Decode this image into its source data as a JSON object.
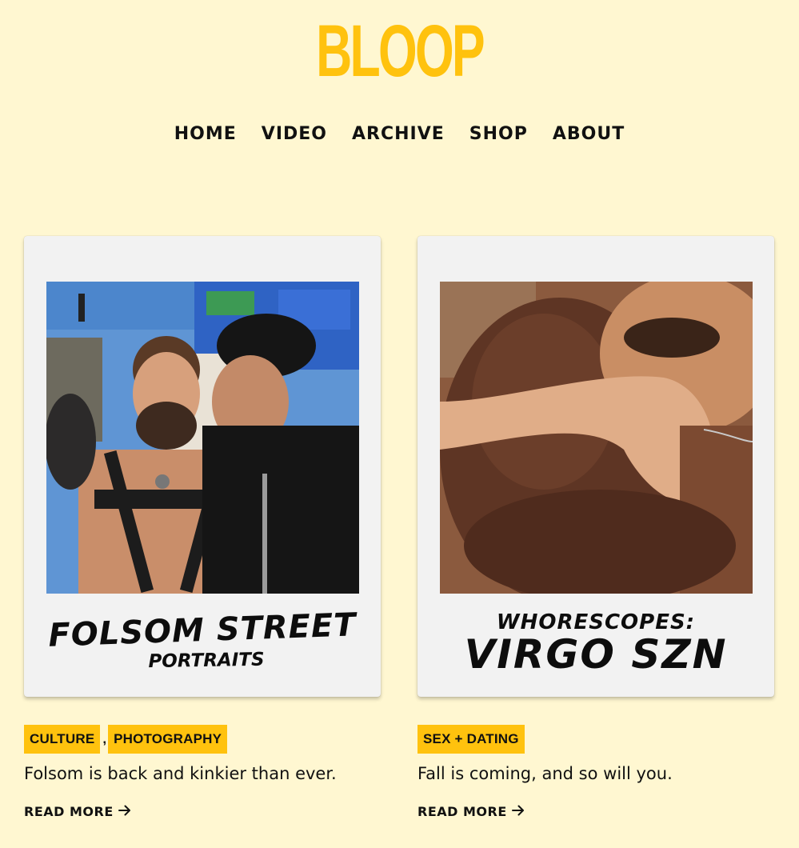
{
  "site": {
    "logo": "BLOOP"
  },
  "nav": {
    "items": [
      "HOME",
      "VIDEO",
      "ARCHIVE",
      "SHOP",
      "ABOUT"
    ]
  },
  "posts": [
    {
      "caption_line1": "FOLSOM STREET",
      "caption_line2": "PORTRAITS",
      "tags": [
        "CULTURE",
        "PHOTOGRAPHY"
      ],
      "tag_separator": ",",
      "excerpt": "Folsom is back and kinkier than ever.",
      "read_more": "READ MORE",
      "read_more_icon": "arrow-right-icon"
    },
    {
      "caption_line1": "WHORESCOPES:",
      "caption_line2": "VIRGO SZN",
      "tags": [
        "SEX + DATING"
      ],
      "excerpt": "Fall is coming, and so will you.",
      "read_more": "READ MORE",
      "read_more_icon": "arrow-right-icon"
    }
  ],
  "colors": {
    "background": "#fff7d1",
    "accent": "#ffc20e",
    "text": "#111111"
  }
}
